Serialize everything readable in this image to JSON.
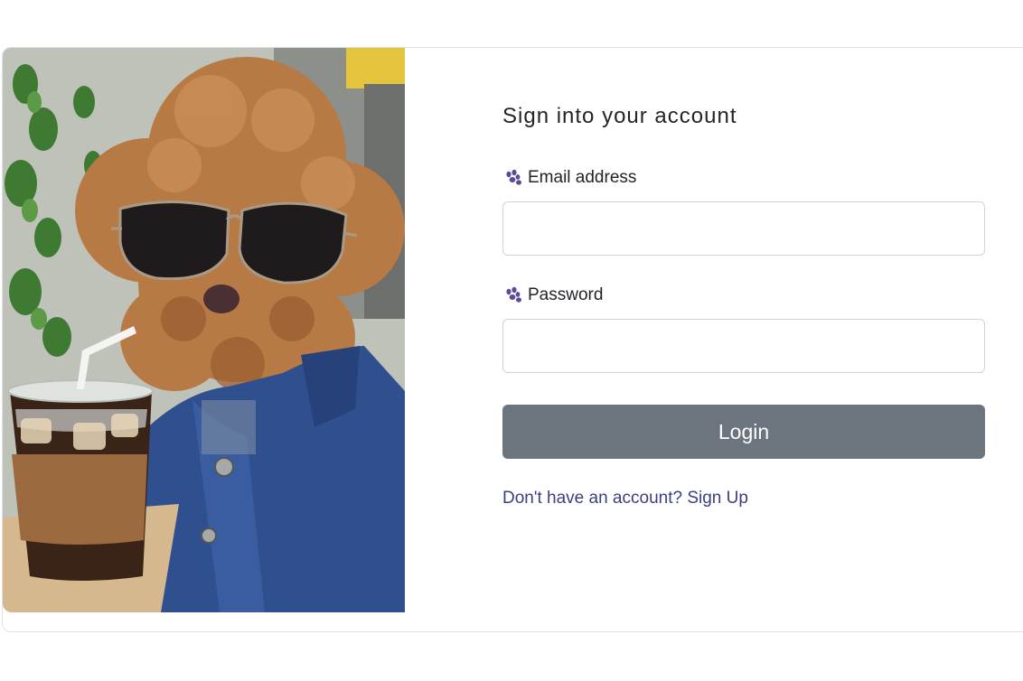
{
  "form": {
    "title": "Sign into your account",
    "email_label": "Email address",
    "email_value": "",
    "password_label": "Password",
    "password_value": "",
    "login_label": "Login",
    "signup_text": "Don't have an account? Sign Up"
  },
  "icons": {
    "field_icon": "paw-icon"
  },
  "colors": {
    "button_bg": "#6c757d",
    "link": "#393f81",
    "paw": "#5b4b9a"
  }
}
